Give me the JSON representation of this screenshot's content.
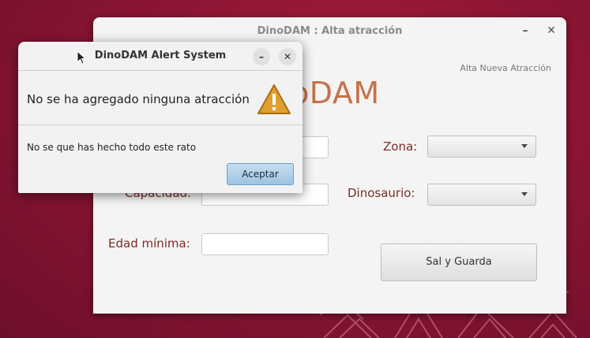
{
  "colors": {
    "desktop": "#8c1533",
    "label": "#7a2c22",
    "logo": "#c37348",
    "accent_button": "#9cc4e2"
  },
  "main_window": {
    "title": "DinoDAM : Alta atracción",
    "subtitle": "Alta Nueva Atracción",
    "logo_text": "oDAM",
    "minimize_glyph": "–",
    "close_glyph": "✕",
    "fields": {
      "capacidad_label": "Capacidad:",
      "edad_label": "Edad mínima:",
      "zona_label": "Zona:",
      "dinosaurio_label": "Dinosaurio:"
    },
    "save_button": "Sal y Guarda"
  },
  "alert": {
    "title": "DinoDAM Alert System",
    "minimize_glyph": "–",
    "close_glyph": "✕",
    "header": "No se ha agregado ninguna atracción",
    "body": "No se que has hecho todo este rato",
    "ok_button": "Aceptar",
    "icon": "warning-icon"
  }
}
